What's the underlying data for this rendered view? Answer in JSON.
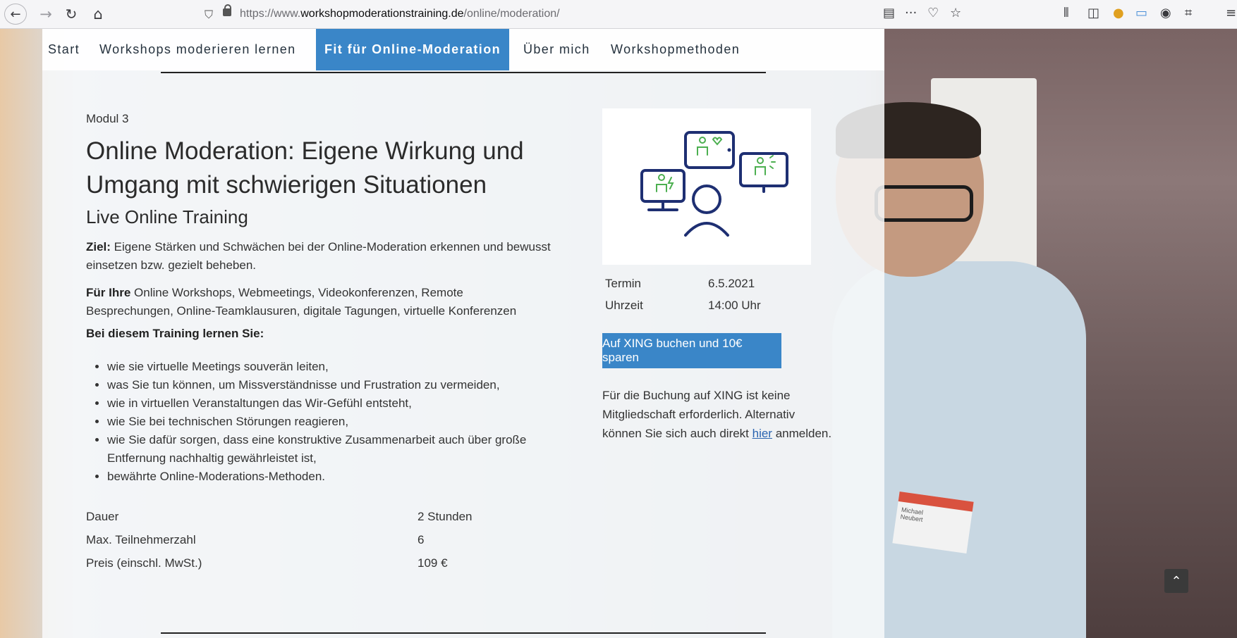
{
  "browser": {
    "url_prefix": "https://www.",
    "url_domain": "workshopmoderationstraining.de",
    "url_path": "/online/moderation/",
    "nav_icons": [
      "back-arrow-icon",
      "forward-arrow-icon",
      "reload-icon",
      "home-icon"
    ],
    "toolbar_icons": [
      "reader-view-icon",
      "more-icon",
      "pocket-icon",
      "star-icon",
      "library-icon",
      "sidebar-icon",
      "extension-icon",
      "screenshot-icon",
      "account-icon",
      "grid-icon",
      "menu-icon"
    ]
  },
  "nav": {
    "items": [
      {
        "label": "Start"
      },
      {
        "label": "Workshops moderieren lernen"
      },
      {
        "label": "Fit für Online-Moderation"
      },
      {
        "label": "Über mich"
      },
      {
        "label": "Workshopmethoden"
      }
    ],
    "active_index": 2
  },
  "course": {
    "module": "Modul 3",
    "title": "Online Moderation: Eigene Wirkung und Umgang mit schwierigen Situationen",
    "subtitle": "Live Online Training",
    "goal_label": "Ziel:",
    "goal_text": " Eigene Stärken und Schwächen bei der Online-Moderation erkennen und bewusst einsetzen bzw. gezielt beheben.",
    "for_label": "Für Ihre",
    "for_text": " Online Workshops, Webmeetings, Videokonferenzen, Remote Besprechungen, Online-Teamklausuren, digitale Tagungen, virtuelle Konferenzen",
    "learn_heading": "Bei diesem Training lernen Sie:",
    "benefits": [
      "wie sie virtuelle Meetings souverän leiten,",
      "was Sie tun können, um Missverständnisse und Frustration zu vermeiden,",
      "wie in virtuellen Veranstaltungen das Wir-Gefühl entsteht,",
      "wie Sie bei technischen Störungen reagieren,",
      "wie Sie dafür sorgen, dass eine konstruktive Zusammenarbeit auch über große Entfernung nachhaltig gewährleistet ist,",
      "bewährte Online-Moderations-Methoden."
    ],
    "facts": [
      {
        "label": "Dauer",
        "value": "2 Stunden"
      },
      {
        "label": "Max. Teilnehmerzahl",
        "value": "6"
      },
      {
        "label": "Preis (einschl. MwSt.)",
        "value": "109 €"
      }
    ]
  },
  "sidebar": {
    "illustration": "online-meeting-illustration",
    "date_label": "Termin",
    "date_value": "6.5.2021",
    "time_label": "Uhrzeit",
    "time_value": "14:00 Uhr",
    "book_button": "Auf XING buchen und 10€ sparen",
    "note_text": "Für die Buchung auf XING ist keine Mitgliedschaft erforderlich. Alternativ können Sie sich auch direkt ",
    "note_link": "hier",
    "note_suffix": " anmelden."
  },
  "photo": {
    "name_tag": "Michael",
    "name_tag_2": "Neubert"
  },
  "colors": {
    "accent": "#3a86c8",
    "illustration_navy": "#1e2f72",
    "illustration_green": "#4caf50"
  }
}
